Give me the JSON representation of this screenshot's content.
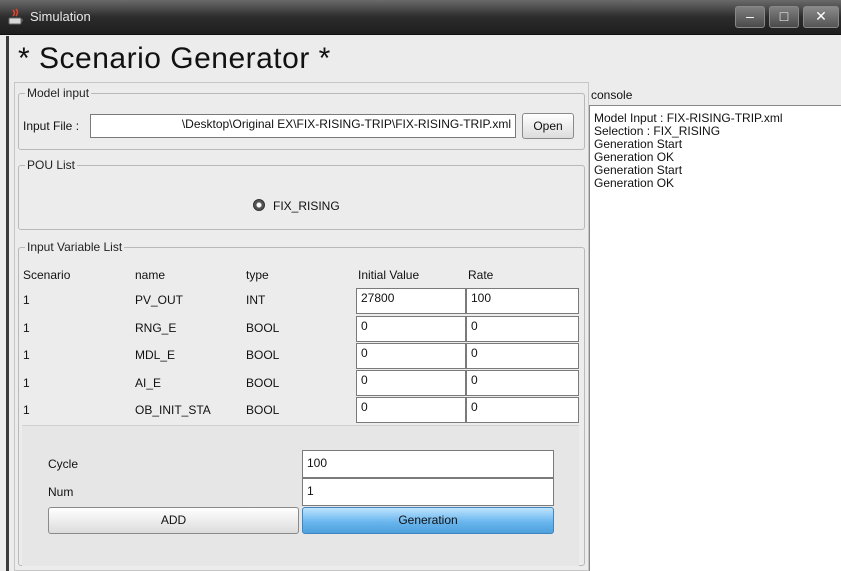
{
  "window": {
    "title": "Simulation",
    "buttons": {
      "minimize": "–",
      "maximize": "□",
      "close": "✕"
    }
  },
  "app_title": "* Scenario Generator *",
  "model_input": {
    "legend": "Model input",
    "file_label": "Input File :",
    "file_value": "\\Desktop\\Original EX\\FIX-RISING-TRIP\\FIX-RISING-TRIP.xml",
    "open_button": "Open"
  },
  "pou_list": {
    "legend": "POU List",
    "options": [
      {
        "label": "FIX_RISING",
        "selected": true
      }
    ]
  },
  "input_variables": {
    "legend": "Input Variable List",
    "headers": [
      "Scenario",
      "name",
      "type",
      "Initial Value",
      "Rate"
    ],
    "rows": [
      {
        "scenario": "1",
        "name": "PV_OUT",
        "type": "INT",
        "initial": "27800",
        "rate": "100"
      },
      {
        "scenario": "1",
        "name": "RNG_E",
        "type": "BOOL",
        "initial": "0",
        "rate": "0"
      },
      {
        "scenario": "1",
        "name": "MDL_E",
        "type": "BOOL",
        "initial": "0",
        "rate": "0"
      },
      {
        "scenario": "1",
        "name": "AI_E",
        "type": "BOOL",
        "initial": "0",
        "rate": "0"
      },
      {
        "scenario": "1",
        "name": "OB_INIT_STA",
        "type": "BOOL",
        "initial": "0",
        "rate": "0"
      }
    ]
  },
  "generation": {
    "cycle_label": "Cycle",
    "cycle_value": "100",
    "num_label": "Num",
    "num_value": "1",
    "add_button": "ADD",
    "generation_button": "Generation"
  },
  "console": {
    "title": "console",
    "lines": [
      "Model Input : FIX-RISING-TRIP.xml",
      "Selection : FIX_RISING",
      "Generation Start",
      "Generation OK",
      "Generation Start",
      "Generation OK"
    ]
  }
}
